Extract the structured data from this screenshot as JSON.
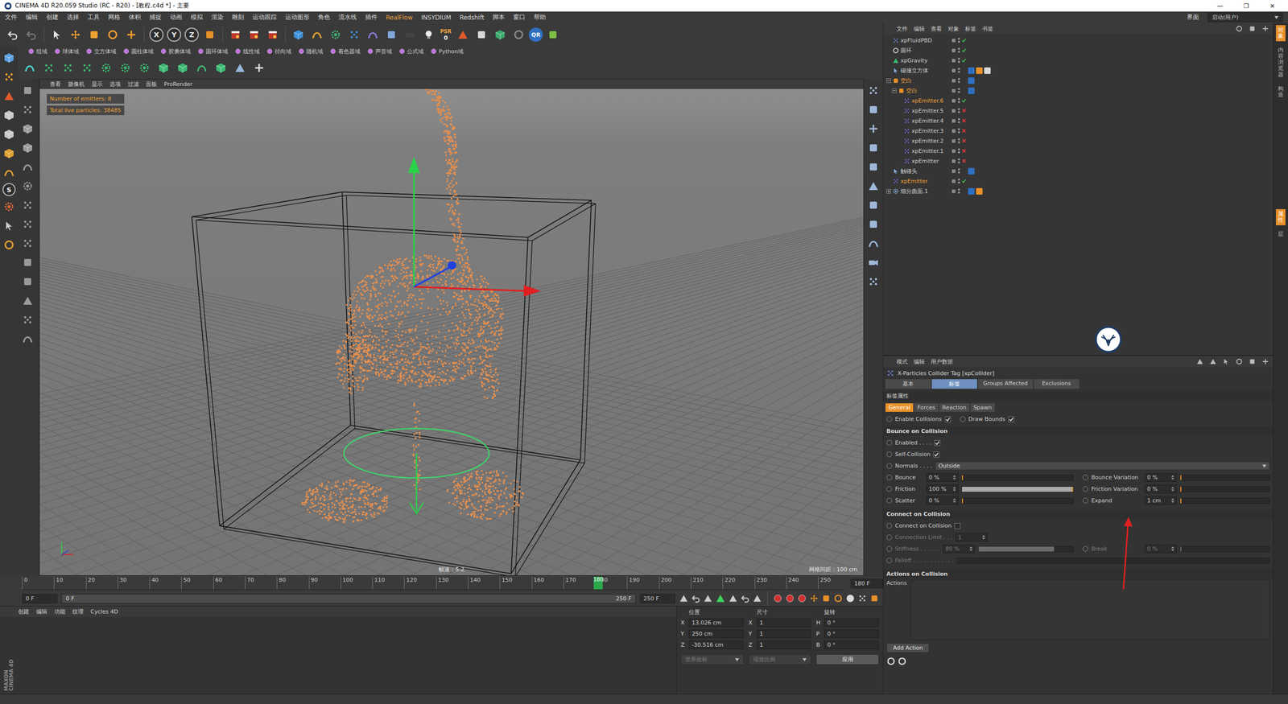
{
  "window": {
    "title": "CINEMA 4D R20.059 Studio (RC - R20) - [教程.c4d *] - 主要",
    "controls": [
      "—",
      "❐",
      "✕"
    ]
  },
  "menu": {
    "items": [
      "文件",
      "编辑",
      "创建",
      "选择",
      "工具",
      "网格",
      "体积",
      "捕捉",
      "动画",
      "模拟",
      "渲染",
      "雕刻",
      "运动跟踪",
      "运动图形",
      "角色",
      "流水线",
      "插件",
      "RealFlow",
      "INSYDIUM",
      "Redshift",
      "脚本",
      "窗口",
      "帮助"
    ],
    "layout_label": "界面",
    "layout_value": "启动(用户)"
  },
  "toolbar": {
    "axes": [
      "X",
      "Y",
      "Z"
    ],
    "psr": "PSR",
    "psr_value": "0",
    "qr": "QR"
  },
  "plugin_groups": [
    "组域",
    "球体域",
    "立方体域",
    "圆柱体域",
    "胶囊体域",
    "圆环体域",
    "线性域",
    "径向域",
    "随机域",
    "着色器域",
    "声音域",
    "公式域",
    "Python域"
  ],
  "left_toolbar": {
    "snap_letter": "S"
  },
  "viewport": {
    "menu": [
      "查看",
      "摄像机",
      "显示",
      "选项",
      "过滤",
      "面板",
      "ProRender"
    ],
    "hud": [
      "Number of emitters: 8",
      "Total live particles: 38485"
    ],
    "fps": "帧速：5.2",
    "grid_spacing": "网格间距：100 cm"
  },
  "timeline": {
    "ticks": [
      "0",
      "10",
      "20",
      "30",
      "40",
      "50",
      "60",
      "70",
      "80",
      "90",
      "100",
      "110",
      "120",
      "130",
      "140",
      "150",
      "160",
      "170",
      "180",
      "190",
      "200",
      "210",
      "220",
      "230",
      "240",
      "250"
    ],
    "current": "180",
    "frame_field": "180 F"
  },
  "playback": {
    "start": "0 F",
    "range_start": "0 F",
    "range_end": "250 F",
    "end": "250 F"
  },
  "materials": {
    "menu": [
      "创建",
      "编辑",
      "功能",
      "纹理",
      "Cycles 4D"
    ],
    "logo": [
      "MAXON",
      "CINEMA 4D"
    ]
  },
  "coordinates": {
    "headers": [
      "位置",
      "尺寸",
      "旋转"
    ],
    "rows": [
      {
        "axis": "X",
        "position": "13.026 cm",
        "size_axis": "X",
        "size": "1",
        "rot_axis": "H",
        "rotation": "0 °"
      },
      {
        "axis": "Y",
        "position": "250 cm",
        "size_axis": "Y",
        "size": "1",
        "rot_axis": "P",
        "rotation": "0 °"
      },
      {
        "axis": "Z",
        "position": "-30.516 cm",
        "size_axis": "Z",
        "size": "1",
        "rot_axis": "B",
        "rotation": "0 °"
      }
    ],
    "mode": {
      "label": "世界坐标",
      "disabled": true
    },
    "scale": {
      "label": "缩放比例",
      "disabled": true
    },
    "apply": "应用"
  },
  "objects": {
    "menu": [
      "文件",
      "编辑",
      "查看",
      "对象",
      "标签",
      "书签"
    ],
    "items": [
      {
        "name": "xpFluidPBD",
        "kind": "solver",
        "depth": 0,
        "selected": false,
        "status": "on",
        "tags": 0
      },
      {
        "name": "圆环",
        "kind": "spline",
        "depth": 0,
        "selected": false,
        "status": "on",
        "tags": 0
      },
      {
        "name": "xpGravity",
        "kind": "modifier",
        "depth": 0,
        "selected": false,
        "status": "on",
        "tags": 0
      },
      {
        "name": "碰撞立方体",
        "kind": "object",
        "depth": 0,
        "selected": false,
        "status": "none",
        "tags": 3
      },
      {
        "name": "空白",
        "kind": "null",
        "depth": 0,
        "selected": true,
        "status": "none",
        "tags": 1,
        "expanded": true
      },
      {
        "name": "空白",
        "kind": "null",
        "depth": 1,
        "selected": true,
        "status": "none",
        "tags": 1,
        "expanded": true
      },
      {
        "name": "xpEmitter.6",
        "kind": "emitter",
        "depth": 2,
        "selected": true,
        "status": "on",
        "tags": 0
      },
      {
        "name": "xpEmitter.5",
        "kind": "emitter",
        "depth": 2,
        "selected": false,
        "status": "off",
        "tags": 0
      },
      {
        "name": "xpEmitter.4",
        "kind": "emitter",
        "depth": 2,
        "selected": false,
        "status": "off",
        "tags": 0
      },
      {
        "name": "xpEmitter.3",
        "kind": "emitter",
        "depth": 2,
        "selected": false,
        "status": "off",
        "tags": 0
      },
      {
        "name": "xpEmitter.2",
        "kind": "emitter",
        "depth": 2,
        "selected": false,
        "status": "off",
        "tags": 0
      },
      {
        "name": "xpEmitter.1",
        "kind": "emitter",
        "depth": 2,
        "selected": false,
        "status": "off",
        "tags": 0
      },
      {
        "name": "xpEmitter",
        "kind": "emitter",
        "depth": 2,
        "selected": false,
        "status": "off",
        "tags": 0
      },
      {
        "name": "触碰头",
        "kind": "object",
        "depth": 0,
        "selected": false,
        "status": "none",
        "tags": 1
      },
      {
        "name": "xpEmitter",
        "kind": "emitter",
        "depth": 0,
        "selected": true,
        "status": "on",
        "tags": 0
      },
      {
        "name": "细分曲面.1",
        "kind": "generator",
        "depth": 0,
        "selected": false,
        "status": "none",
        "tags": 2,
        "expanded": false
      }
    ]
  },
  "attributes": {
    "menu": [
      "模式",
      "编辑",
      "用户数据"
    ],
    "title": "X-Particles Collider Tag [xpCollider]",
    "tabs": [
      {
        "label": "基本",
        "selected": false
      },
      {
        "label": "标签",
        "selected": true
      },
      {
        "label": "Groups Affected",
        "selected": false
      },
      {
        "label": "Exclusions",
        "selected": false
      }
    ],
    "section": "标签属性",
    "subtabs": [
      {
        "label": "General",
        "selected": true
      },
      {
        "label": "Forces",
        "selected": false
      },
      {
        "label": "Reaction",
        "selected": false
      },
      {
        "label": "Spawn",
        "selected": false
      }
    ],
    "top_checks": [
      {
        "label": "Enable Collisions",
        "checked": true
      },
      {
        "label": "Draw Bounds",
        "checked": true
      }
    ],
    "groups": [
      {
        "title": "Bounce on Collision",
        "rows": [
          {
            "kind": "check",
            "label": "Enabled . . . .",
            "checked": true,
            "disabled": false
          },
          {
            "kind": "check",
            "label": "Self-Collision",
            "checked": true,
            "disabled": false
          },
          {
            "kind": "select",
            "label": "Normals . . . .",
            "value": "Outside",
            "disabled": false
          },
          {
            "kind": "pair",
            "disabled": false,
            "params": [
              {
                "label": "Bounce",
                "value": "0 %",
                "level": 0
              },
              {
                "label": "Bounce Variation",
                "value": "0 %",
                "level": 0
              }
            ]
          },
          {
            "kind": "pair",
            "disabled": false,
            "params": [
              {
                "label": "Friction",
                "value": "100 %",
                "level": 1
              },
              {
                "label": "Friction Variation",
                "value": "0 %",
                "level": 0
              }
            ]
          },
          {
            "kind": "pair",
            "disabled": false,
            "params": [
              {
                "label": "Scatter",
                "value": "0 %",
                "level": 0
              },
              {
                "label": "Expand",
                "value": "1 cm",
                "level": 0.01
              }
            ]
          }
        ]
      },
      {
        "title": "Connect on Collision",
        "rows": [
          {
            "kind": "check",
            "label": "Connect on Collision",
            "checked": false,
            "disabled": false
          },
          {
            "kind": "field",
            "label": "Connection Limit . . .",
            "value": "1",
            "disabled": true
          },
          {
            "kind": "pair",
            "disabled": true,
            "params": [
              {
                "label": "Stiffness . . . . . .",
                "value": "80 %",
                "level": 0.8
              },
              {
                "label": "Break",
                "value": "0 %",
                "level": 0
              }
            ]
          },
          {
            "kind": "falloff",
            "label": "Falloff . . . . . . . . . . . .",
            "disabled": true
          }
        ]
      }
    ],
    "actions": {
      "title": "Actions on Collision",
      "label": "Actions",
      "button": "Add Action"
    }
  },
  "side_tabs": {
    "top": [
      {
        "label": "对象",
        "selected": true
      },
      {
        "label": "内容浏览器",
        "selected": false
      },
      {
        "label": "构造",
        "selected": false
      }
    ],
    "bottom": [
      {
        "label": "属性",
        "selected": true
      },
      {
        "label": "层",
        "selected": false
      }
    ]
  }
}
